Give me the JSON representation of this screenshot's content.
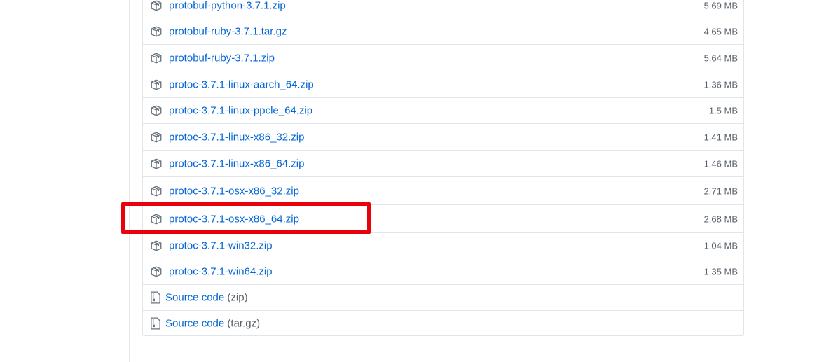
{
  "assets": [
    {
      "name": "protobuf-python-3.7.1.zip",
      "size": "5.69 MB",
      "icon": "package-icon"
    },
    {
      "name": "protobuf-ruby-3.7.1.tar.gz",
      "size": "4.65 MB",
      "icon": "package-icon"
    },
    {
      "name": "protobuf-ruby-3.7.1.zip",
      "size": "5.64 MB",
      "icon": "package-icon"
    },
    {
      "name": "protoc-3.7.1-linux-aarch_64.zip",
      "size": "1.36 MB",
      "icon": "package-icon"
    },
    {
      "name": "protoc-3.7.1-linux-ppcle_64.zip",
      "size": "1.5 MB",
      "icon": "package-icon"
    },
    {
      "name": "protoc-3.7.1-linux-x86_32.zip",
      "size": "1.41 MB",
      "icon": "package-icon"
    },
    {
      "name": "protoc-3.7.1-linux-x86_64.zip",
      "size": "1.46 MB",
      "icon": "package-icon"
    },
    {
      "name": "protoc-3.7.1-osx-x86_32.zip",
      "size": "2.71 MB",
      "icon": "package-icon"
    },
    {
      "name": "protoc-3.7.1-osx-x86_64.zip",
      "size": "2.68 MB",
      "icon": "package-icon",
      "highlighted": true
    },
    {
      "name": "protoc-3.7.1-win32.zip",
      "size": "1.04 MB",
      "icon": "package-icon"
    },
    {
      "name": "protoc-3.7.1-win64.zip",
      "size": "1.35 MB",
      "icon": "package-icon"
    }
  ],
  "source_code": [
    {
      "label": "Source code",
      "suffix": "(zip)",
      "icon": "file-zip-icon"
    },
    {
      "label": "Source code",
      "suffix": "(tar.gz)",
      "icon": "file-zip-icon"
    }
  ],
  "colors": {
    "link": "#0366d6",
    "muted": "#586069",
    "border": "#e1e4e8",
    "highlight": "#e8000b"
  }
}
